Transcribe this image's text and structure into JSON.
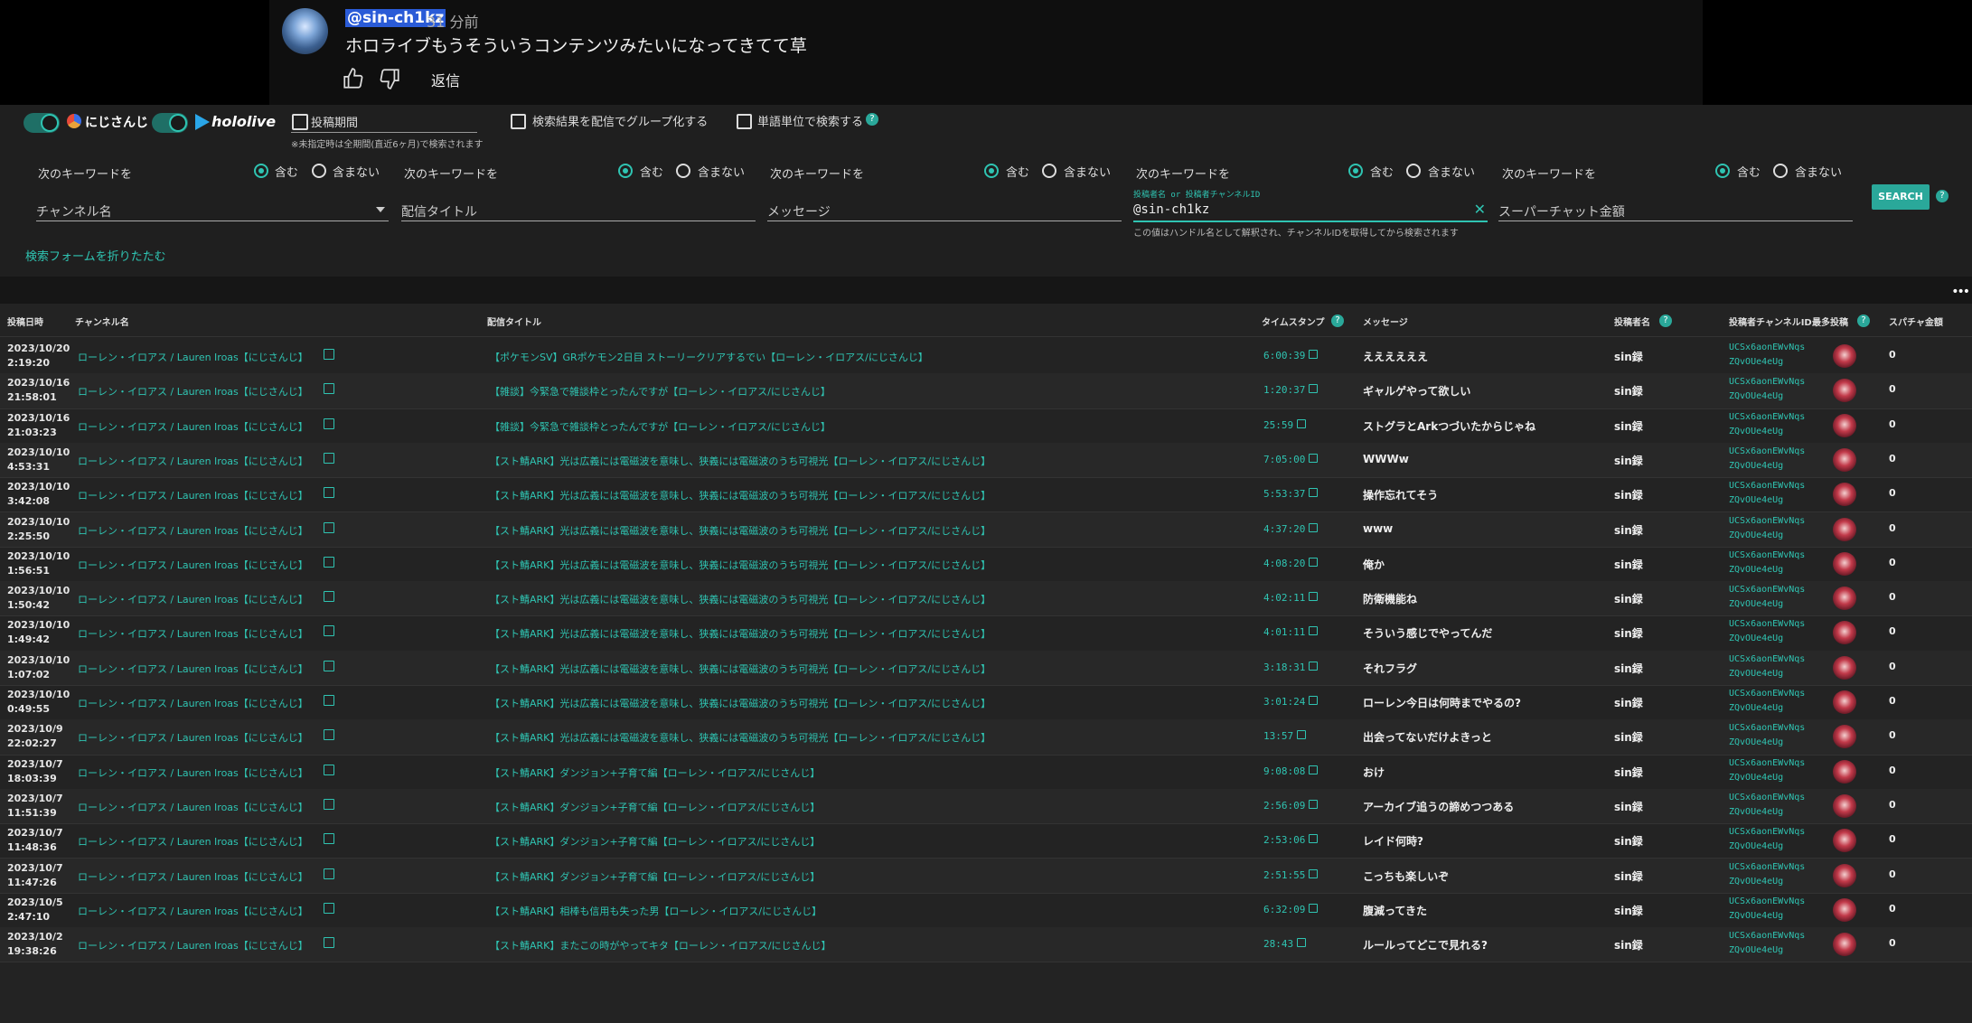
{
  "youtube_comment": {
    "handle": "@sin-ch1kz",
    "time": "31 分前",
    "text": "ホロライブもうそういうコンテンツみたいになってきてて草",
    "reply_label": "返信",
    "like_icon": "thumbs-up-icon",
    "dislike_icon": "thumbs-down-icon"
  },
  "filters": {
    "brand_nijisanji": "にじさんじ",
    "brand_hololive": "hololive",
    "period_label": "投稿期間",
    "period_note": "※未指定時は全期間(直近6ヶ月)で検索されます",
    "group_checkbox": "検索結果を配信でグループ化する",
    "word_checkbox": "単語単位で検索する"
  },
  "keyword_groups": [
    {
      "label": "次のキーワードを",
      "include": "含む",
      "exclude": "含まない",
      "field": "チャンネル名"
    },
    {
      "label": "次のキーワードを",
      "include": "含む",
      "exclude": "含まない",
      "field": "配信タイトル"
    },
    {
      "label": "次のキーワードを",
      "include": "含む",
      "exclude": "含まない",
      "field": "メッセージ"
    },
    {
      "label": "次のキーワードを",
      "include": "含む",
      "exclude": "含まない",
      "field": "@sin-ch1kz",
      "small": "投稿者名 or 投稿者チャンネルID"
    },
    {
      "label": "次のキーワードを",
      "include": "含む",
      "exclude": "含まない",
      "field": "スーパーチャット金額"
    }
  ],
  "handle_note": "この値はハンドル名として解釈され、チャンネルIDを取得してから検索されます",
  "search_label": "SEARCH",
  "collapse_label": "検索フォームを折りたたむ",
  "table": {
    "headers": [
      "投稿日時",
      "チャンネル名",
      "配信タイトル",
      "タイムスタンプ",
      "メッセージ",
      "投稿者名",
      "投稿者チャンネルID",
      "最多投稿",
      "スパチャ金額"
    ],
    "rows": [
      {
        "date1": "2023/10/20",
        "date2": "2:19:20",
        "channel": "ローレン・イロアス / Lauren Iroas【にじさんじ】",
        "title": "【ポケモンSV】GRポケモン2日目 ストーリークリアするでい【ローレン・イロアス/にじさんじ】",
        "ts": "6:00:39",
        "msg": "ええええええ",
        "author": "sin録",
        "chid1": "UCSx6aonEWvNqs",
        "chid2": "ZQvOUe4eUg",
        "sc": "0"
      },
      {
        "date1": "2023/10/16",
        "date2": "21:58:01",
        "channel": "ローレン・イロアス / Lauren Iroas【にじさんじ】",
        "title": "【雑談】今緊急で雑談枠とったんですが【ローレン・イロアス/にじさんじ】",
        "ts": "1:20:37",
        "msg": "ギャルゲやって欲しい",
        "author": "sin録",
        "chid1": "UCSx6aonEWvNqs",
        "chid2": "ZQvOUe4eUg",
        "sc": "0"
      },
      {
        "date1": "2023/10/16",
        "date2": "21:03:23",
        "channel": "ローレン・イロアス / Lauren Iroas【にじさんじ】",
        "title": "【雑談】今緊急で雑談枠とったんですが【ローレン・イロアス/にじさんじ】",
        "ts": "25:59",
        "msg": "ストグラとArkつづいたからじゃね",
        "author": "sin録",
        "chid1": "UCSx6aonEWvNqs",
        "chid2": "ZQvOUe4eUg",
        "sc": "0"
      },
      {
        "date1": "2023/10/10",
        "date2": "4:53:31",
        "channel": "ローレン・イロアス / Lauren Iroas【にじさんじ】",
        "title": "【スト鯖ARK】光は広義には電磁波を意味し、狭義には電磁波のうち可視光【ローレン・イロアス/にじさんじ】",
        "ts": "7:05:00",
        "msg": "WWWw",
        "author": "sin録",
        "chid1": "UCSx6aonEWvNqs",
        "chid2": "ZQvOUe4eUg",
        "sc": "0"
      },
      {
        "date1": "2023/10/10",
        "date2": "3:42:08",
        "channel": "ローレン・イロアス / Lauren Iroas【にじさんじ】",
        "title": "【スト鯖ARK】光は広義には電磁波を意味し、狭義には電磁波のうち可視光【ローレン・イロアス/にじさんじ】",
        "ts": "5:53:37",
        "msg": "操作忘れてそう",
        "author": "sin録",
        "chid1": "UCSx6aonEWvNqs",
        "chid2": "ZQvOUe4eUg",
        "sc": "0"
      },
      {
        "date1": "2023/10/10",
        "date2": "2:25:50",
        "channel": "ローレン・イロアス / Lauren Iroas【にじさんじ】",
        "title": "【スト鯖ARK】光は広義には電磁波を意味し、狭義には電磁波のうち可視光【ローレン・イロアス/にじさんじ】",
        "ts": "4:37:20",
        "msg": "www",
        "author": "sin録",
        "chid1": "UCSx6aonEWvNqs",
        "chid2": "ZQvOUe4eUg",
        "sc": "0"
      },
      {
        "date1": "2023/10/10",
        "date2": "1:56:51",
        "channel": "ローレン・イロアス / Lauren Iroas【にじさんじ】",
        "title": "【スト鯖ARK】光は広義には電磁波を意味し、狭義には電磁波のうち可視光【ローレン・イロアス/にじさんじ】",
        "ts": "4:08:20",
        "msg": "俺か",
        "author": "sin録",
        "chid1": "UCSx6aonEWvNqs",
        "chid2": "ZQvOUe4eUg",
        "sc": "0"
      },
      {
        "date1": "2023/10/10",
        "date2": "1:50:42",
        "channel": "ローレン・イロアス / Lauren Iroas【にじさんじ】",
        "title": "【スト鯖ARK】光は広義には電磁波を意味し、狭義には電磁波のうち可視光【ローレン・イロアス/にじさんじ】",
        "ts": "4:02:11",
        "msg": "防衛機能ね",
        "author": "sin録",
        "chid1": "UCSx6aonEWvNqs",
        "chid2": "ZQvOUe4eUg",
        "sc": "0"
      },
      {
        "date1": "2023/10/10",
        "date2": "1:49:42",
        "channel": "ローレン・イロアス / Lauren Iroas【にじさんじ】",
        "title": "【スト鯖ARK】光は広義には電磁波を意味し、狭義には電磁波のうち可視光【ローレン・イロアス/にじさんじ】",
        "ts": "4:01:11",
        "msg": "そういう感じでやってんだ",
        "author": "sin録",
        "chid1": "UCSx6aonEWvNqs",
        "chid2": "ZQvOUe4eUg",
        "sc": "0"
      },
      {
        "date1": "2023/10/10",
        "date2": "1:07:02",
        "channel": "ローレン・イロアス / Lauren Iroas【にじさんじ】",
        "title": "【スト鯖ARK】光は広義には電磁波を意味し、狭義には電磁波のうち可視光【ローレン・イロアス/にじさんじ】",
        "ts": "3:18:31",
        "msg": "それフラグ",
        "author": "sin録",
        "chid1": "UCSx6aonEWvNqs",
        "chid2": "ZQvOUe4eUg",
        "sc": "0"
      },
      {
        "date1": "2023/10/10",
        "date2": "0:49:55",
        "channel": "ローレン・イロアス / Lauren Iroas【にじさんじ】",
        "title": "【スト鯖ARK】光は広義には電磁波を意味し、狭義には電磁波のうち可視光【ローレン・イロアス/にじさんじ】",
        "ts": "3:01:24",
        "msg": "ローレン今日は何時までやるの?",
        "author": "sin録",
        "chid1": "UCSx6aonEWvNqs",
        "chid2": "ZQvOUe4eUg",
        "sc": "0"
      },
      {
        "date1": "2023/10/9",
        "date2": "22:02:27",
        "channel": "ローレン・イロアス / Lauren Iroas【にじさんじ】",
        "title": "【スト鯖ARK】光は広義には電磁波を意味し、狭義には電磁波のうち可視光【ローレン・イロアス/にじさんじ】",
        "ts": "13:57",
        "msg": "出会ってないだけよきっと",
        "author": "sin録",
        "chid1": "UCSx6aonEWvNqs",
        "chid2": "ZQvOUe4eUg",
        "sc": "0"
      },
      {
        "date1": "2023/10/7",
        "date2": "18:03:39",
        "channel": "ローレン・イロアス / Lauren Iroas【にじさんじ】",
        "title": "【スト鯖ARK】ダンジョン+子育て編【ローレン・イロアス/にじさんじ】",
        "ts": "9:08:08",
        "msg": "おけ",
        "author": "sin録",
        "chid1": "UCSx6aonEWvNqs",
        "chid2": "ZQvOUe4eUg",
        "sc": "0"
      },
      {
        "date1": "2023/10/7",
        "date2": "11:51:39",
        "channel": "ローレン・イロアス / Lauren Iroas【にじさんじ】",
        "title": "【スト鯖ARK】ダンジョン+子育て編【ローレン・イロアス/にじさんじ】",
        "ts": "2:56:09",
        "msg": "アーカイブ追うの諦めつつある",
        "author": "sin録",
        "chid1": "UCSx6aonEWvNqs",
        "chid2": "ZQvOUe4eUg",
        "sc": "0"
      },
      {
        "date1": "2023/10/7",
        "date2": "11:48:36",
        "channel": "ローレン・イロアス / Lauren Iroas【にじさんじ】",
        "title": "【スト鯖ARK】ダンジョン+子育て編【ローレン・イロアス/にじさんじ】",
        "ts": "2:53:06",
        "msg": "レイド何時?",
        "author": "sin録",
        "chid1": "UCSx6aonEWvNqs",
        "chid2": "ZQvOUe4eUg",
        "sc": "0"
      },
      {
        "date1": "2023/10/7",
        "date2": "11:47:26",
        "channel": "ローレン・イロアス / Lauren Iroas【にじさんじ】",
        "title": "【スト鯖ARK】ダンジョン+子育て編【ローレン・イロアス/にじさんじ】",
        "ts": "2:51:55",
        "msg": "こっちも楽しいぞ",
        "author": "sin録",
        "chid1": "UCSx6aonEWvNqs",
        "chid2": "ZQvOUe4eUg",
        "sc": "0"
      },
      {
        "date1": "2023/10/5",
        "date2": "2:47:10",
        "channel": "ローレン・イロアス / Lauren Iroas【にじさんじ】",
        "title": "【スト鯖ARK】相棒も信用も失った男【ローレン・イロアス/にじさんじ】",
        "ts": "6:32:09",
        "msg": "腹減ってきた",
        "author": "sin録",
        "chid1": "UCSx6aonEWvNqs",
        "chid2": "ZQvOUe4eUg",
        "sc": "0"
      },
      {
        "date1": "2023/10/2",
        "date2": "19:38:26",
        "channel": "ローレン・イロアス / Lauren Iroas【にじさんじ】",
        "title": "【スト鯖ARK】またこの時がやってキタ【ローレン・イロアス/にじさんじ】",
        "ts": "28:43",
        "msg": "ルールってどこで見れる?",
        "author": "sin録",
        "chid1": "UCSx6aonEWvNqs",
        "chid2": "ZQvOUe4eUg",
        "sc": "0"
      }
    ]
  },
  "colors": {
    "accent": "#2fc4b2",
    "background": "#232323"
  }
}
